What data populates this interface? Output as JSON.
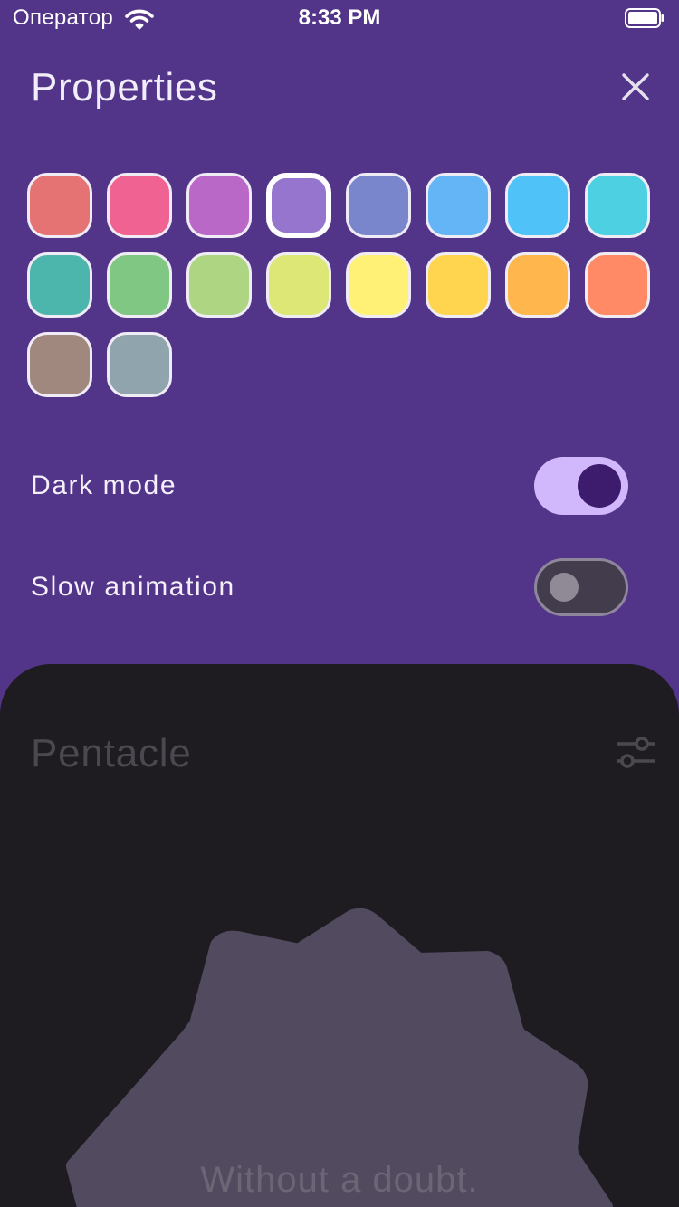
{
  "status_bar": {
    "carrier": "Оператор",
    "time": "8:33 PM",
    "wifi_icon": "wifi-icon",
    "battery_icon": "battery-icon"
  },
  "properties_sheet": {
    "title": "Properties",
    "close_icon": "close-icon",
    "background_color": "#523489",
    "selected_color_index": 3,
    "colors": [
      "#e57373",
      "#f06292",
      "#ba68c8",
      "#9575cd",
      "#7986cb",
      "#64b5f6",
      "#4fc3f7",
      "#4dd0e1",
      "#4db6ac",
      "#81c784",
      "#aed581",
      "#dce775",
      "#fff176",
      "#ffd54f",
      "#ffb74d",
      "#ff8a65",
      "#a1887f",
      "#90a4ae"
    ],
    "settings": [
      {
        "label": "Dark mode",
        "on": true
      },
      {
        "label": "Slow animation",
        "on": false
      }
    ]
  },
  "main": {
    "title": "Pentacle",
    "tune_icon": "tune-icon",
    "answer": "Without a doubt.",
    "shape_color": "#524a5e"
  }
}
